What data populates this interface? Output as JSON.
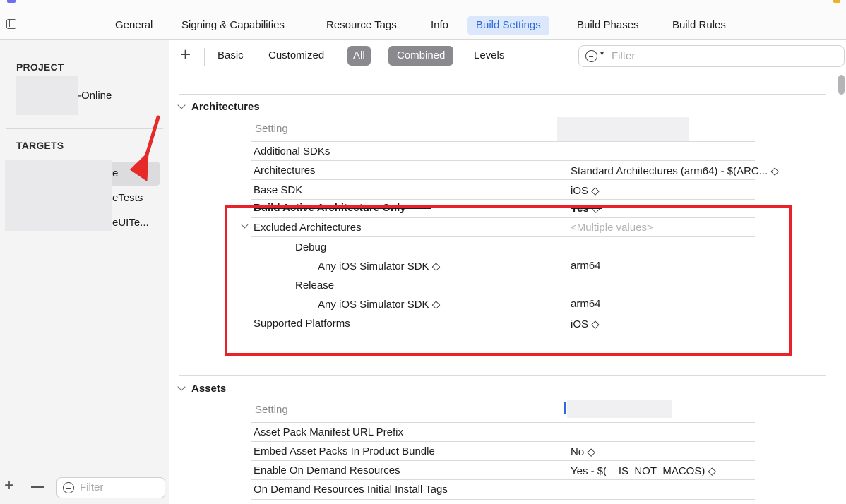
{
  "tabs": [
    {
      "label": "General",
      "active": false
    },
    {
      "label": "Signing & Capabilities",
      "active": false
    },
    {
      "label": "Resource Tags",
      "active": false
    },
    {
      "label": "Info",
      "active": false
    },
    {
      "label": "Build Settings",
      "active": true
    },
    {
      "label": "Build Phases",
      "active": false
    },
    {
      "label": "Build Rules",
      "active": false
    }
  ],
  "sidebar": {
    "project_header": "PROJECT",
    "project_name": "-Online",
    "targets_header": "TARGETS",
    "targets": [
      {
        "label": "e",
        "selected": true
      },
      {
        "label": "eTests",
        "selected": false
      },
      {
        "label": "eUITe...",
        "selected": false
      }
    ],
    "filter_placeholder": "Filter"
  },
  "toolbar": {
    "basic": "Basic",
    "customized": "Customized",
    "all": "All",
    "combined": "Combined",
    "levels": "Levels",
    "filter_placeholder": "Filter"
  },
  "architectures": {
    "title": "Architectures",
    "setting_header": "Setting",
    "rows": {
      "additional_sdks": "Additional SDKs",
      "architectures_label": "Architectures",
      "architectures_value": "Standard Architectures (arm64)  -  $(ARC...  ◇",
      "base_sdk_label": "Base SDK",
      "base_sdk_value": "iOS ◇",
      "build_active_label": "Build Active Architecture Only",
      "build_active_value": "Yes ◇",
      "excluded_label": "Excluded Architectures",
      "excluded_value": "<Multiple values>",
      "debug_label": "Debug",
      "debug_sdk_label": "Any iOS Simulator SDK ◇",
      "debug_sdk_value": "arm64",
      "release_label": "Release",
      "release_sdk_label": "Any iOS Simulator SDK ◇",
      "release_sdk_value": "arm64",
      "supported_label": "Supported Platforms",
      "supported_value": "iOS ◇"
    }
  },
  "assets": {
    "title": "Assets",
    "setting_header": "Setting",
    "rows": {
      "manifest_label": "Asset Pack Manifest URL Prefix",
      "embed_label": "Embed Asset Packs In Product Bundle",
      "embed_value": "No ◇",
      "on_demand_label": "Enable On Demand Resources",
      "on_demand_value": "Yes  -  $(__IS_NOT_MACOS) ◇",
      "initial_tags_label": "On Demand Resources Initial Install Tags"
    }
  },
  "colors": {
    "accent": "#2e68d9",
    "highlight_box": "#ea2128",
    "pill": "#8a8a8e"
  }
}
